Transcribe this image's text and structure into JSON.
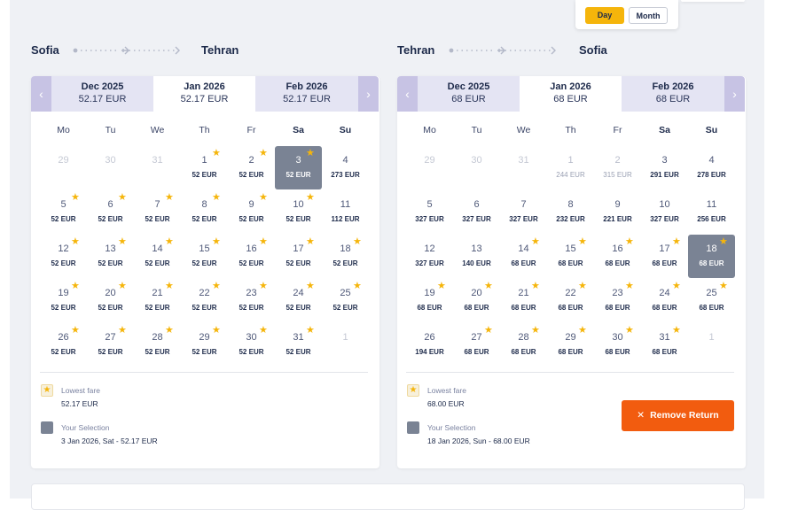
{
  "view_toggle": {
    "day_label": "Day",
    "month_label": "Month",
    "active": "Day"
  },
  "colors": {
    "accent_yellow": "#f5b50b",
    "tab_purple": "#c7c3e4",
    "selected_gray": "#7a8394",
    "remove_orange": "#f25c0f"
  },
  "outbound": {
    "from": "Sofia",
    "to": "Tehran",
    "tabs": [
      {
        "month": "Dec 2025",
        "price": "52.17 EUR",
        "active": false
      },
      {
        "month": "Jan 2026",
        "price": "52.17 EUR",
        "active": true
      },
      {
        "month": "Feb 2026",
        "price": "52.17 EUR",
        "active": false
      }
    ],
    "weekdays": [
      "Mo",
      "Tu",
      "We",
      "Th",
      "Fr",
      "Sa",
      "Su"
    ],
    "days": [
      {
        "d": "29",
        "p": "",
        "s": false,
        "state": "empty"
      },
      {
        "d": "30",
        "p": "",
        "s": false,
        "state": "empty"
      },
      {
        "d": "31",
        "p": "",
        "s": false,
        "state": "empty"
      },
      {
        "d": "1",
        "p": "52 EUR",
        "s": true,
        "state": ""
      },
      {
        "d": "2",
        "p": "52 EUR",
        "s": true,
        "state": ""
      },
      {
        "d": "3",
        "p": "52 EUR",
        "s": true,
        "state": "selected"
      },
      {
        "d": "4",
        "p": "273 EUR",
        "s": false,
        "state": ""
      },
      {
        "d": "5",
        "p": "52 EUR",
        "s": true,
        "state": ""
      },
      {
        "d": "6",
        "p": "52 EUR",
        "s": true,
        "state": ""
      },
      {
        "d": "7",
        "p": "52 EUR",
        "s": true,
        "state": ""
      },
      {
        "d": "8",
        "p": "52 EUR",
        "s": true,
        "state": ""
      },
      {
        "d": "9",
        "p": "52 EUR",
        "s": true,
        "state": ""
      },
      {
        "d": "10",
        "p": "52 EUR",
        "s": true,
        "state": ""
      },
      {
        "d": "11",
        "p": "112 EUR",
        "s": false,
        "state": ""
      },
      {
        "d": "12",
        "p": "52 EUR",
        "s": true,
        "state": ""
      },
      {
        "d": "13",
        "p": "52 EUR",
        "s": true,
        "state": ""
      },
      {
        "d": "14",
        "p": "52 EUR",
        "s": true,
        "state": ""
      },
      {
        "d": "15",
        "p": "52 EUR",
        "s": true,
        "state": ""
      },
      {
        "d": "16",
        "p": "52 EUR",
        "s": true,
        "state": ""
      },
      {
        "d": "17",
        "p": "52 EUR",
        "s": true,
        "state": ""
      },
      {
        "d": "18",
        "p": "52 EUR",
        "s": true,
        "state": ""
      },
      {
        "d": "19",
        "p": "52 EUR",
        "s": true,
        "state": ""
      },
      {
        "d": "20",
        "p": "52 EUR",
        "s": true,
        "state": ""
      },
      {
        "d": "21",
        "p": "52 EUR",
        "s": true,
        "state": ""
      },
      {
        "d": "22",
        "p": "52 EUR",
        "s": true,
        "state": ""
      },
      {
        "d": "23",
        "p": "52 EUR",
        "s": true,
        "state": ""
      },
      {
        "d": "24",
        "p": "52 EUR",
        "s": true,
        "state": ""
      },
      {
        "d": "25",
        "p": "52 EUR",
        "s": true,
        "state": ""
      },
      {
        "d": "26",
        "p": "52 EUR",
        "s": true,
        "state": ""
      },
      {
        "d": "27",
        "p": "52 EUR",
        "s": true,
        "state": ""
      },
      {
        "d": "28",
        "p": "52 EUR",
        "s": true,
        "state": ""
      },
      {
        "d": "29",
        "p": "52 EUR",
        "s": true,
        "state": ""
      },
      {
        "d": "30",
        "p": "52 EUR",
        "s": true,
        "state": ""
      },
      {
        "d": "31",
        "p": "52 EUR",
        "s": true,
        "state": ""
      },
      {
        "d": "1",
        "p": "",
        "s": false,
        "state": "empty"
      }
    ],
    "legend": {
      "lowest_label": "Lowest fare",
      "lowest_value": "52.17 EUR",
      "selection_label": "Your Selection",
      "selection_value": "3 Jan 2026, Sat - 52.17 EUR"
    }
  },
  "return": {
    "from": "Tehran",
    "to": "Sofia",
    "tabs": [
      {
        "month": "Dec 2025",
        "price": "68 EUR",
        "active": false
      },
      {
        "month": "Jan 2026",
        "price": "68 EUR",
        "active": true
      },
      {
        "month": "Feb 2026",
        "price": "68 EUR",
        "active": false
      }
    ],
    "weekdays": [
      "Mo",
      "Tu",
      "We",
      "Th",
      "Fr",
      "Sa",
      "Su"
    ],
    "days": [
      {
        "d": "29",
        "p": "",
        "s": false,
        "state": "empty"
      },
      {
        "d": "30",
        "p": "",
        "s": false,
        "state": "empty"
      },
      {
        "d": "31",
        "p": "",
        "s": false,
        "state": "empty"
      },
      {
        "d": "1",
        "p": "244 EUR",
        "s": false,
        "state": "faded"
      },
      {
        "d": "2",
        "p": "315 EUR",
        "s": false,
        "state": "faded"
      },
      {
        "d": "3",
        "p": "291 EUR",
        "s": false,
        "state": ""
      },
      {
        "d": "4",
        "p": "278 EUR",
        "s": false,
        "state": ""
      },
      {
        "d": "5",
        "p": "327 EUR",
        "s": false,
        "state": ""
      },
      {
        "d": "6",
        "p": "327 EUR",
        "s": false,
        "state": ""
      },
      {
        "d": "7",
        "p": "327 EUR",
        "s": false,
        "state": ""
      },
      {
        "d": "8",
        "p": "232 EUR",
        "s": false,
        "state": ""
      },
      {
        "d": "9",
        "p": "221 EUR",
        "s": false,
        "state": ""
      },
      {
        "d": "10",
        "p": "327 EUR",
        "s": false,
        "state": ""
      },
      {
        "d": "11",
        "p": "256 EUR",
        "s": false,
        "state": ""
      },
      {
        "d": "12",
        "p": "327 EUR",
        "s": false,
        "state": ""
      },
      {
        "d": "13",
        "p": "140 EUR",
        "s": false,
        "state": ""
      },
      {
        "d": "14",
        "p": "68 EUR",
        "s": true,
        "state": ""
      },
      {
        "d": "15",
        "p": "68 EUR",
        "s": true,
        "state": ""
      },
      {
        "d": "16",
        "p": "68 EUR",
        "s": true,
        "state": ""
      },
      {
        "d": "17",
        "p": "68 EUR",
        "s": true,
        "state": ""
      },
      {
        "d": "18",
        "p": "68 EUR",
        "s": true,
        "state": "selected"
      },
      {
        "d": "19",
        "p": "68 EUR",
        "s": true,
        "state": ""
      },
      {
        "d": "20",
        "p": "68 EUR",
        "s": true,
        "state": ""
      },
      {
        "d": "21",
        "p": "68 EUR",
        "s": true,
        "state": ""
      },
      {
        "d": "22",
        "p": "68 EUR",
        "s": true,
        "state": ""
      },
      {
        "d": "23",
        "p": "68 EUR",
        "s": true,
        "state": ""
      },
      {
        "d": "24",
        "p": "68 EUR",
        "s": true,
        "state": ""
      },
      {
        "d": "25",
        "p": "68 EUR",
        "s": true,
        "state": ""
      },
      {
        "d": "26",
        "p": "194 EUR",
        "s": false,
        "state": ""
      },
      {
        "d": "27",
        "p": "68 EUR",
        "s": true,
        "state": ""
      },
      {
        "d": "28",
        "p": "68 EUR",
        "s": true,
        "state": ""
      },
      {
        "d": "29",
        "p": "68 EUR",
        "s": true,
        "state": ""
      },
      {
        "d": "30",
        "p": "68 EUR",
        "s": true,
        "state": ""
      },
      {
        "d": "31",
        "p": "68 EUR",
        "s": true,
        "state": ""
      },
      {
        "d": "1",
        "p": "",
        "s": false,
        "state": "empty"
      }
    ],
    "legend": {
      "lowest_label": "Lowest fare",
      "lowest_value": "68.00 EUR",
      "selection_label": "Your Selection",
      "selection_value": "18 Jan 2026, Sun - 68.00 EUR"
    },
    "remove_button_label": "Remove Return"
  }
}
